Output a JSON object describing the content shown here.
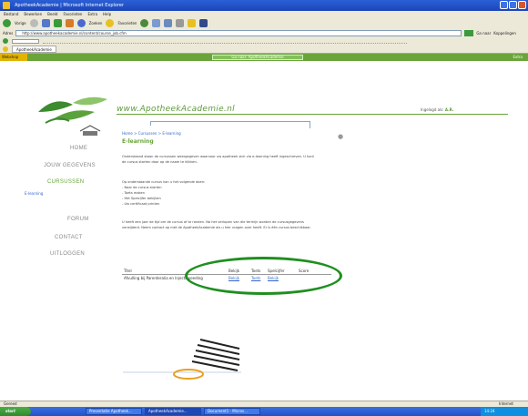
{
  "window": {
    "title": "ApotheekAcademie | Microsoft Internet Explorer"
  },
  "menus": [
    "Bestand",
    "Bewerken",
    "Beeld",
    "Favorieten",
    "Extra",
    "Help"
  ],
  "toolbar": {
    "back_label": "Vorige",
    "search_label": "Zoeken",
    "favorites_label": "Favorieten"
  },
  "address": {
    "label": "Adres",
    "url": "http://www.apotheekacademie.nl/content/course_job.cfm",
    "go_label": "Ga naar",
    "links_label": "Koppelingen"
  },
  "tab": {
    "label": "ApotheekAcademie"
  },
  "sitebar": {
    "left_label": "Webshop",
    "center_button": "Ga naar: ApotheekAcademie",
    "right_label": "Extra"
  },
  "site": {
    "logo": "www.ApotheekAcademie.nl",
    "login_prefix": "Ingelogd als:",
    "login_user": "A.R."
  },
  "nav": {
    "home": "HOME",
    "mydata": "JOUW GEGEVENS",
    "courses": "CURSUSSEN",
    "sub": "E-learning",
    "forum": "FORUM",
    "contact": "CONTACT",
    "logout": "UITLOGGEN"
  },
  "page": {
    "breadcrumb": "Home > Cursussen > E-learning",
    "title": "E-learning",
    "intro": "Onderstaand staan de cursussen weergegeven waarvoor uw apotheek zich via e-learning heeft ingeschreven. U kunt de cursus starten door op de naam te klikken.",
    "list_heading": "Op onderstaande cursus kan u het volgende doen:",
    "bullets": [
      "- Naar de cursus starten",
      "- Toets maken",
      "- Het Spelcijfer bekijken",
      "- Uw certificaat printen"
    ],
    "note": "U heeft een jaar de tijd om de cursus af te ronden. Na het verlopen van die termijn worden de cursusgegevens verwijderd. Neem contact op met de ApotheekAcademie als u hier vragen over heeft. Er is één cursus beschikbaar."
  },
  "table": {
    "headers": [
      "Titel",
      "Bekijk",
      "Toets",
      "Spelcijfer",
      "Score"
    ],
    "rows": [
      {
        "title": "Afvulling bij Parenteralia en Injectievoeding",
        "view": "Bekijk",
        "test": "Toets",
        "spelcijfer": "Bekijk"
      }
    ]
  },
  "status": {
    "left": "Gereed",
    "right": "Internet"
  },
  "taskbar": {
    "start": "start",
    "tasks": [
      "Presentatie Apotheek...",
      "ApotheekAcademie...",
      "Document1 - Micros..."
    ],
    "clock": "14:24"
  }
}
